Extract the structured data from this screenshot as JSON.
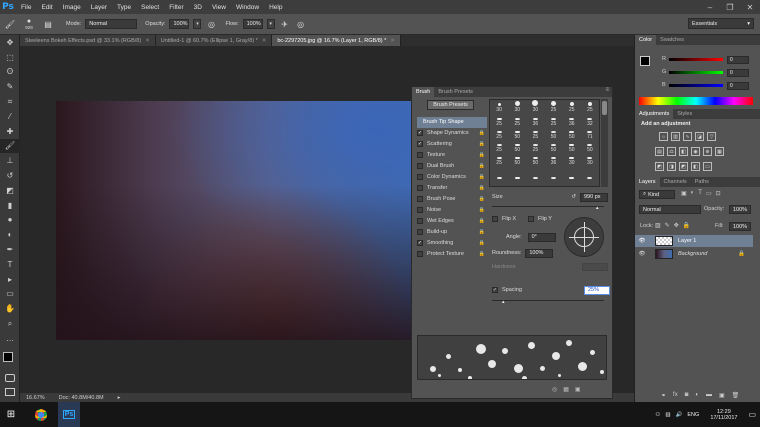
{
  "app": {
    "logo": "Ps",
    "menu": [
      "File",
      "Edit",
      "Image",
      "Layer",
      "Type",
      "Select",
      "Filter",
      "3D",
      "View",
      "Window",
      "Help"
    ],
    "window_controls": [
      "–",
      "❐",
      "✕"
    ]
  },
  "options": {
    "brush_size": "929",
    "mode_label": "Mode:",
    "mode_value": "Normal",
    "opacity_label": "Opacity:",
    "opacity_value": "100%",
    "flow_label": "Flow:",
    "flow_value": "100%",
    "workspace": "Essentials"
  },
  "doc_tabs": [
    {
      "label": "Steeleens Bokeh Effects.psd @ 33.1% (RGB/8)"
    },
    {
      "label": "Untitled-1 @ 60.7% (Ellipse 1, Gray/8) *"
    },
    {
      "label": "bc-2297205.jpg @ 16.7% (Layer 1, RGB/8) *"
    }
  ],
  "status": {
    "zoom": "16.67%",
    "doc": "Doc: 40.8M/40.8M"
  },
  "brush_panel": {
    "tabs": [
      "Brush",
      "Brush Presets"
    ],
    "presets_button": "Brush Presets",
    "options": [
      {
        "label": "Brush Tip Shape",
        "checked": ""
      },
      {
        "label": "Shape Dynamics",
        "checked": "✓"
      },
      {
        "label": "Scattering",
        "checked": "✓"
      },
      {
        "label": "Texture",
        "checked": ""
      },
      {
        "label": "Dual Brush",
        "checked": ""
      },
      {
        "label": "Color Dynamics",
        "checked": ""
      },
      {
        "label": "Transfer",
        "checked": ""
      },
      {
        "label": "Brush Pose",
        "checked": ""
      },
      {
        "label": "Noise",
        "checked": ""
      },
      {
        "label": "Wet Edges",
        "checked": ""
      },
      {
        "label": "Build-up",
        "checked": ""
      },
      {
        "label": "Smoothing",
        "checked": "✓"
      },
      {
        "label": "Protect Texture",
        "checked": ""
      }
    ],
    "tips": [
      "30",
      "30",
      "30",
      "25",
      "25",
      "25",
      "25",
      "25",
      "36",
      "25",
      "36",
      "32",
      "25",
      "50",
      "25",
      "50",
      "50",
      "71",
      "25",
      "50",
      "25",
      "50",
      "50",
      "50",
      "25",
      "50",
      "50",
      "36",
      "30",
      "30",
      "",
      "",
      "",
      "",
      "",
      ""
    ],
    "size_label": "Size",
    "size_value": "990 px",
    "flipx": "Flip X",
    "flipy": "Flip Y",
    "angle_label": "Angle:",
    "angle_value": "0°",
    "round_label": "Roundness:",
    "round_value": "100%",
    "hardness_label": "Hardness",
    "spacing_label": "Spacing",
    "spacing_value": "25%"
  },
  "color_panel": {
    "tabs": [
      "Color",
      "Swatches"
    ],
    "r_label": "R",
    "g_label": "G",
    "b_label": "B",
    "r": "0",
    "g": "0",
    "b": "0"
  },
  "adjust_panel": {
    "tabs": [
      "Adjustments",
      "Styles"
    ],
    "title": "Add an adjustment"
  },
  "layers_panel": {
    "tabs": [
      "Layers",
      "Channels",
      "Paths"
    ],
    "filter": "Kind",
    "blend": "Normal",
    "opacity_label": "Opacity:",
    "opacity": "100%",
    "lock_label": "Lock:",
    "fill_label": "Fill:",
    "fill": "100%",
    "layers": [
      {
        "name": "Layer 1"
      },
      {
        "name": "Background"
      }
    ]
  },
  "taskbar": {
    "lang": "ENG",
    "time": "12:29",
    "date": "17/11/2017"
  }
}
